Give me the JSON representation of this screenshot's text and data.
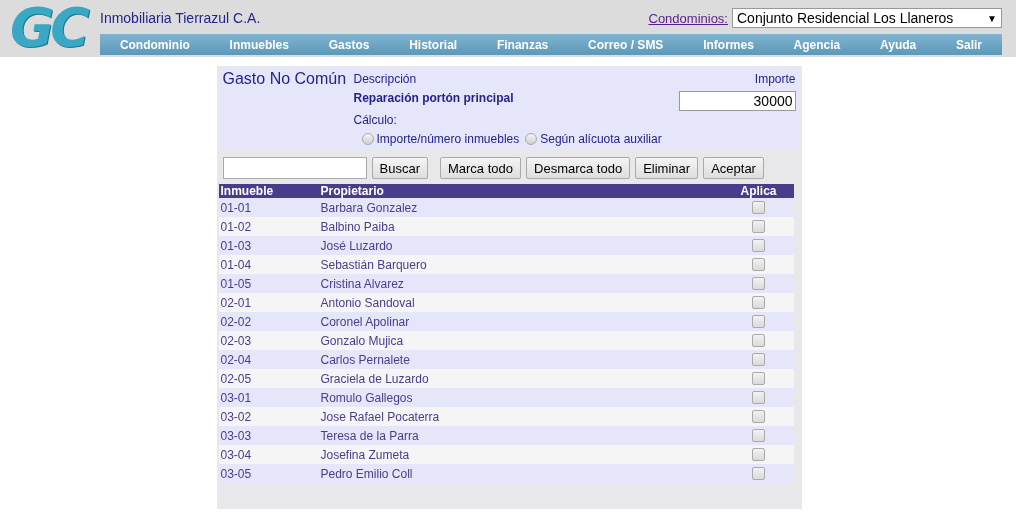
{
  "header": {
    "logo": "GC",
    "company": "Inmobiliaria Tierrazul C.A.",
    "condominios_link": "Condominios:",
    "condominio_select": "Conjunto Residencial Los Llaneros",
    "select_arrow": "▼"
  },
  "nav": [
    "Condominio",
    "Inmuebles",
    "Gastos",
    "Historial",
    "Finanzas",
    "Correo / SMS",
    "Informes",
    "Agencia",
    "Ayuda",
    "Salir"
  ],
  "form": {
    "title": "Gasto No Común",
    "description_label": "Descripción",
    "description": "Reparación portón principal",
    "importe_label": "Importe",
    "importe": "30000",
    "calculo_label": "Cálculo:",
    "options": [
      {
        "label": "Importe/número inmuebles",
        "selected": false
      },
      {
        "label": "Según alícuota auxiliar",
        "selected": false
      }
    ]
  },
  "toolbar": {
    "buttons": [
      "Buscar",
      "Marca todo",
      "Desmarca todo",
      "Eliminar",
      "Aceptar"
    ]
  },
  "table": {
    "columns": [
      "Inmueble",
      "Propietario",
      "Aplica"
    ],
    "rows": [
      {
        "inmueble": "01-01",
        "propietario": "Barbara Gonzalez",
        "checked": false
      },
      {
        "inmueble": "01-02",
        "propietario": "Balbino Paiba",
        "checked": false
      },
      {
        "inmueble": "01-03",
        "propietario": "José Luzardo",
        "checked": false
      },
      {
        "inmueble": "01-04",
        "propietario": "Sebastián Barquero",
        "checked": false
      },
      {
        "inmueble": "01-05",
        "propietario": "Cristina Alvarez",
        "checked": false
      },
      {
        "inmueble": "02-01",
        "propietario": "Antonio Sandoval",
        "checked": false
      },
      {
        "inmueble": "02-02",
        "propietario": "Coronel Apolinar",
        "checked": false
      },
      {
        "inmueble": "02-03",
        "propietario": "Gonzalo Mujica",
        "checked": false
      },
      {
        "inmueble": "02-04",
        "propietario": "Carlos Pernalete",
        "checked": false
      },
      {
        "inmueble": "02-05",
        "propietario": "Graciela de Luzardo",
        "checked": false
      },
      {
        "inmueble": "03-01",
        "propietario": "Romulo Gallegos",
        "checked": false
      },
      {
        "inmueble": "03-02",
        "propietario": "Jose Rafael Pocaterra",
        "checked": false
      },
      {
        "inmueble": "03-03",
        "propietario": "Teresa de la Parra",
        "checked": false
      },
      {
        "inmueble": "03-04",
        "propietario": "Josefina Zumeta",
        "checked": false
      },
      {
        "inmueble": "03-05",
        "propietario": "Pedro Emilio Coll",
        "checked": false
      }
    ]
  }
}
